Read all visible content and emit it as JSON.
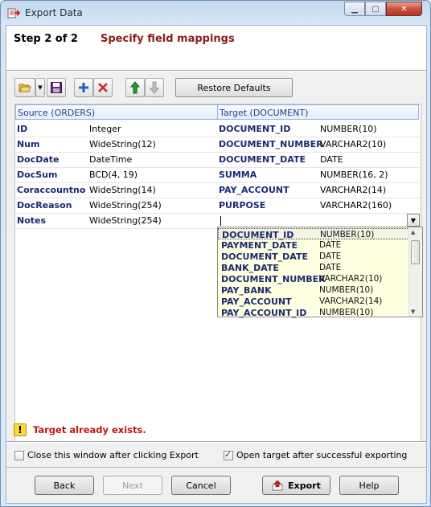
{
  "window": {
    "title": "Export Data"
  },
  "header": {
    "step": "Step 2 of 2",
    "caption": "Specify field mappings"
  },
  "toolbar": {
    "restore_label": "Restore Defaults"
  },
  "grid": {
    "source_header": "Source (ORDERS)",
    "target_header": "Target (DOCUMENT)",
    "rows": [
      {
        "src_name": "ID",
        "src_type": "Integer",
        "tgt_name": "DOCUMENT_ID",
        "tgt_type": "NUMBER(10)"
      },
      {
        "src_name": "Num",
        "src_type": "WideString(12)",
        "tgt_name": "DOCUMENT_NUMBER",
        "tgt_type": "VARCHAR2(10)"
      },
      {
        "src_name": "DocDate",
        "src_type": "DateTime",
        "tgt_name": "DOCUMENT_DATE",
        "tgt_type": "DATE"
      },
      {
        "src_name": "DocSum",
        "src_type": "BCD(4, 19)",
        "tgt_name": "SUMMA",
        "tgt_type": "NUMBER(16, 2)"
      },
      {
        "src_name": "Coraccountno",
        "src_type": "WideString(14)",
        "tgt_name": "PAY_ACCOUNT",
        "tgt_type": "VARCHAR2(14)"
      },
      {
        "src_name": "DocReason",
        "src_type": "WideString(254)",
        "tgt_name": "PURPOSE",
        "tgt_type": "VARCHAR2(160)"
      },
      {
        "src_name": "Notes",
        "src_type": "WideString(254)",
        "tgt_name": "",
        "tgt_type": ""
      }
    ]
  },
  "dropdown": {
    "items": [
      {
        "name": "DOCUMENT_ID",
        "type": "NUMBER(10)"
      },
      {
        "name": "PAYMENT_DATE",
        "type": "DATE"
      },
      {
        "name": "DOCUMENT_DATE",
        "type": "DATE"
      },
      {
        "name": "BANK_DATE",
        "type": "DATE"
      },
      {
        "name": "DOCUMENT_NUMBER",
        "type": "VARCHAR2(10)"
      },
      {
        "name": "PAY_BANK",
        "type": "NUMBER(10)"
      },
      {
        "name": "PAY_ACCOUNT",
        "type": "VARCHAR2(14)"
      },
      {
        "name": "PAY_ACCOUNT_ID",
        "type": "NUMBER(10)"
      }
    ]
  },
  "status": {
    "warning": "Target already exists.",
    "icon": "warning-icon",
    "color": "#c41414"
  },
  "options": {
    "close_label": "Close this window after clicking Export",
    "close_checked": false,
    "open_label": "Open target after successful exporting",
    "open_checked": true
  },
  "buttons": {
    "back": "Back",
    "next": "Next",
    "cancel": "Cancel",
    "export": "Export",
    "help": "Help"
  }
}
